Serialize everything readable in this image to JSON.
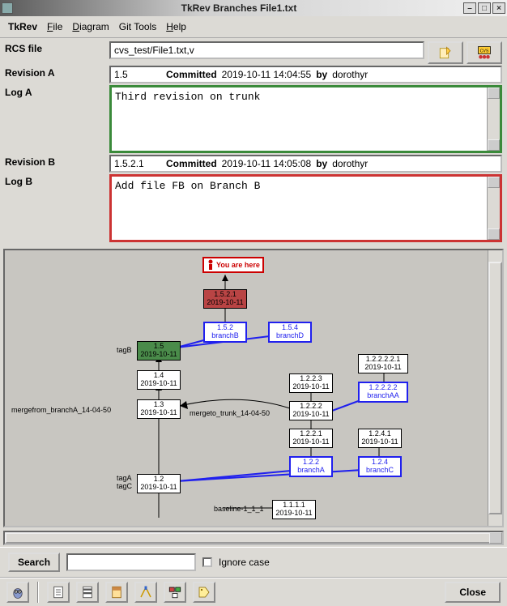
{
  "window": {
    "title": "TkRev Branches File1.txt"
  },
  "menu": {
    "app": "TkRev",
    "file": "File",
    "diagram": "Diagram",
    "gitTools": "Git Tools",
    "help": "Help"
  },
  "labels": {
    "rcsFile": "RCS file",
    "revA": "Revision A",
    "logA": "Log A",
    "revB": "Revision B",
    "logB": "Log B",
    "committed": "Committed",
    "by": "by",
    "search": "Search",
    "ignoreCase": "Ignore case",
    "close": "Close",
    "youAreHere": "You are here"
  },
  "fields": {
    "rcsFile": "cvs_test/File1.txt,v",
    "revA": {
      "rev": "1.5",
      "date": "2019-10-11 14:04:55",
      "user": "dorothyr"
    },
    "logA": "Third revision on trunk",
    "revB": {
      "rev": "1.5.2.1",
      "date": "2019-10-11 14:05:08",
      "user": "dorothyr"
    },
    "logB": "Add file FB on Branch B",
    "searchValue": ""
  },
  "diagram": {
    "tags": {
      "tagB": "tagB",
      "mergeFrom": "mergefrom_branchA_14-04-50",
      "mergeTo": "mergeto_trunk_14-04-50",
      "tagA": "tagA",
      "tagC": "tagC",
      "baseline": "baseline-1_1_1"
    },
    "nodes": {
      "n1521": {
        "rev": "1.5.2.1",
        "date": "2019-10-11"
      },
      "n152": {
        "rev": "1.5.2",
        "name": "branchB"
      },
      "n154": {
        "rev": "1.5.4",
        "name": "branchD"
      },
      "n15": {
        "rev": "1.5",
        "date": "2019-10-11"
      },
      "n14": {
        "rev": "1.4",
        "date": "2019-10-11"
      },
      "n13": {
        "rev": "1.3",
        "date": "2019-10-11"
      },
      "n12": {
        "rev": "1.2",
        "date": "2019-10-11"
      },
      "n1223": {
        "rev": "1.2.2.3",
        "date": "2019-10-11"
      },
      "n1222": {
        "rev": "1.2.2.2",
        "date": "2019-10-11"
      },
      "n1221": {
        "rev": "1.2.2.1",
        "date": "2019-10-11"
      },
      "n122": {
        "rev": "1.2.2",
        "name": "branchA"
      },
      "n122221": {
        "rev": "1.2.2.2.2.1",
        "date": "2019-10-11"
      },
      "n12222": {
        "rev": "1.2.2.2.2",
        "name": "branchAA"
      },
      "n1241": {
        "rev": "1.2.4.1",
        "date": "2019-10-11"
      },
      "n124": {
        "rev": "1.2.4",
        "name": "branchC"
      },
      "n1111": {
        "rev": "1.1.1.1",
        "date": "2019-10-11"
      }
    }
  },
  "icons": {
    "edit": "edit-icon",
    "cvs": "cvs-icon",
    "owl": "owl-icon",
    "page1": "page-icon",
    "page2": "striped-page-icon",
    "page3": "shaded-page-icon",
    "pen": "pen-icon",
    "blocks": "blocks-icon",
    "tag": "tag-icon"
  }
}
